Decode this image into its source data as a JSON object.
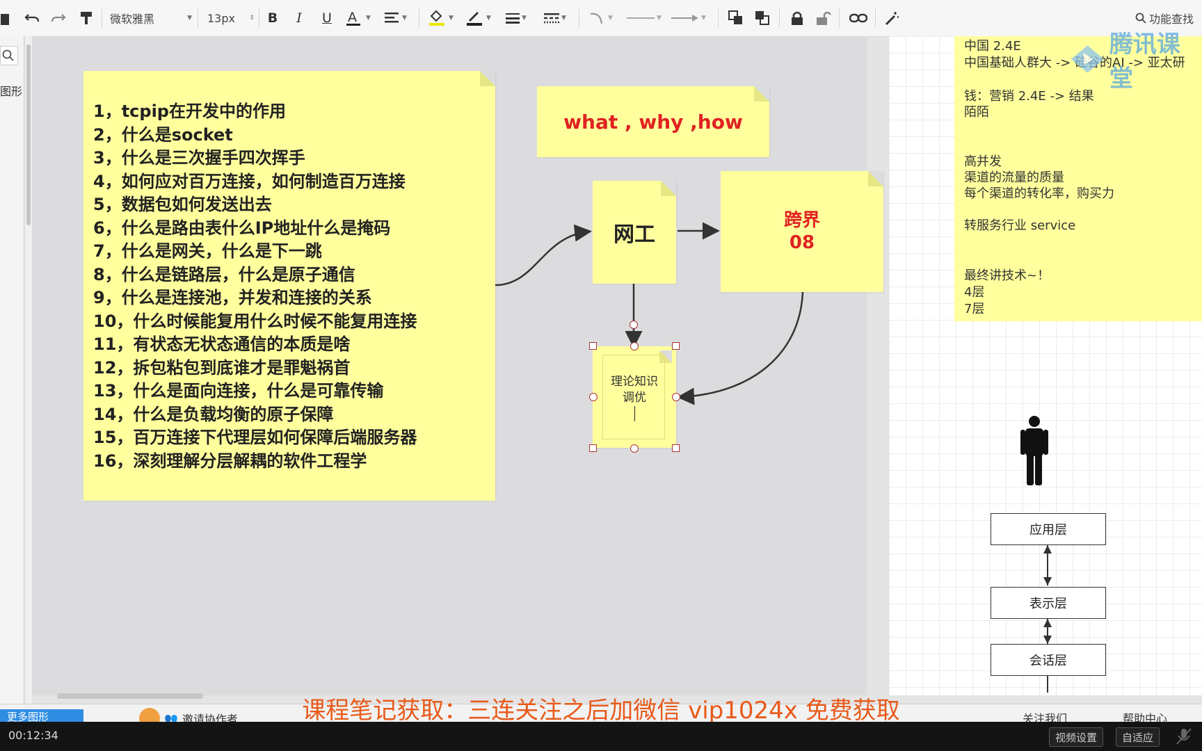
{
  "toolbar": {
    "font_family": "微软雅黑",
    "font_size": "13px",
    "search_label": "功能查找"
  },
  "sidebar": {
    "shapes_label": "图形",
    "more_shapes": "更多图形"
  },
  "canvas": {
    "list_items": [
      "1，tcpip在开发中的作用",
      "2，什么是socket",
      "3，什么是三次握手四次挥手",
      "4，如何应对百万连接，如何制造百万连接",
      "5，数据包如何发送出去",
      "6，什么是路由表什么IP地址什么是掩码",
      "7，什么是网关，什么是下一跳",
      "8，什么是链路层，什么是原子通信",
      "9，什么是连接池，并发和连接的关系",
      "10，什么时候能复用什么时候不能复用连接",
      "11，有状态无状态通信的本质是啥",
      "12，拆包粘包到底谁才是罪魁祸首",
      "13，什么是面向连接，什么是可靠传输",
      "14，什么是负载均衡的原子保障",
      "15，百万连接下代理层如何保障后端服务器",
      "16，深刻理解分层解耦的软件工程学"
    ],
    "what_why_how": "what , why ,how",
    "wanggong": "网工",
    "kuajie_line1": "跨界",
    "kuajie_line2": "08",
    "theory_line1": "理论知识",
    "theory_line2": "调优"
  },
  "right_note": {
    "lines": [
      "中国 2.4E",
      "中国基础人群大  -> 硅谷的AI -> 亚太研",
      "钱：营销 2.4E  ->  结果",
      "陌陌",
      "高并发",
      "渠道的流量的质量",
      "每个渠道的转化率，购买力",
      "转服务行业   service",
      "最终讲技术~！",
      "4层",
      "7层"
    ]
  },
  "layers": [
    "应用层",
    "表示层",
    "会话层"
  ],
  "watermark": "腾讯课堂",
  "bottom": {
    "invite": "邀请协作者",
    "follow": "关注我们",
    "help": "帮助中心"
  },
  "subtitle": "课程笔记获取：三连关注之后加微信 vip1024x 免费获取",
  "player": {
    "time": "00:12:34",
    "video_settings": "视频设置",
    "fit": "自适应"
  },
  "colors": {
    "note_yellow": "#ffff9e",
    "accent_red": "#e02222",
    "subtitle_orange": "#e85a1a"
  }
}
